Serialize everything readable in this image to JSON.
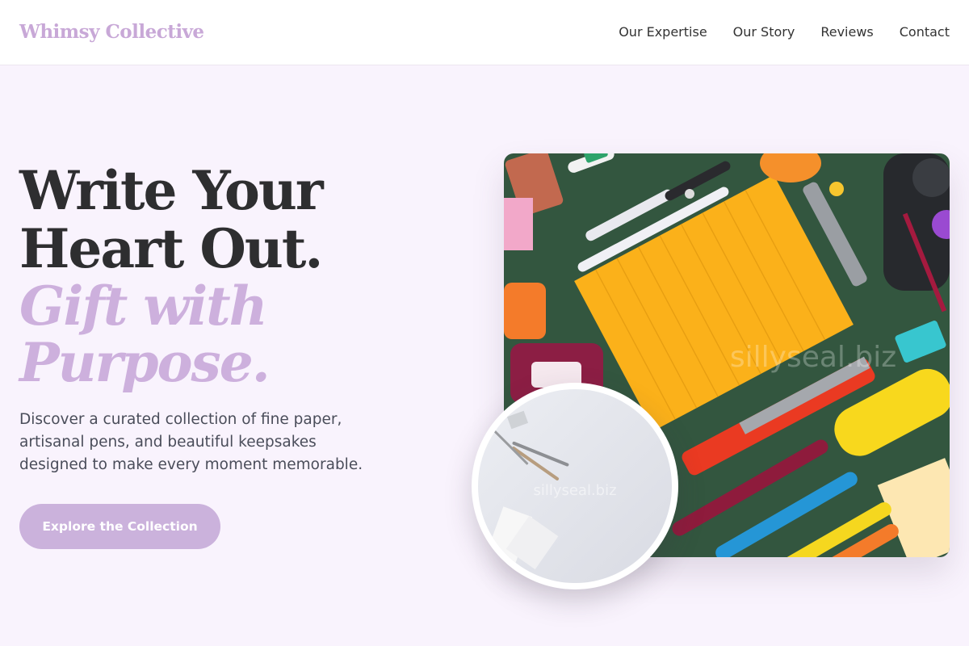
{
  "nav": {
    "brand": "Whimsy Collective",
    "links": [
      "Our Expertise",
      "Our Story",
      "Reviews",
      "Contact"
    ]
  },
  "hero": {
    "headline_line1": "Write Your",
    "headline_line2": "Heart Out.",
    "accent_line1": "Gift with",
    "accent_line2": "Purpose.",
    "description": "Discover a curated collection of fine paper, artisanal pens, and beautiful keepsakes designed to make every moment memorable.",
    "cta_label": "Explore the Collection"
  },
  "images": {
    "main_watermark": "sillyseal.biz",
    "inset_watermark": "sillyseal.biz"
  },
  "colors": {
    "brand": "#c8a8d7",
    "accent_text": "#cdb0dd",
    "cta_background": "#cbb2dc",
    "page_background": "#f9f3fd",
    "photo_background": "#33563f"
  }
}
